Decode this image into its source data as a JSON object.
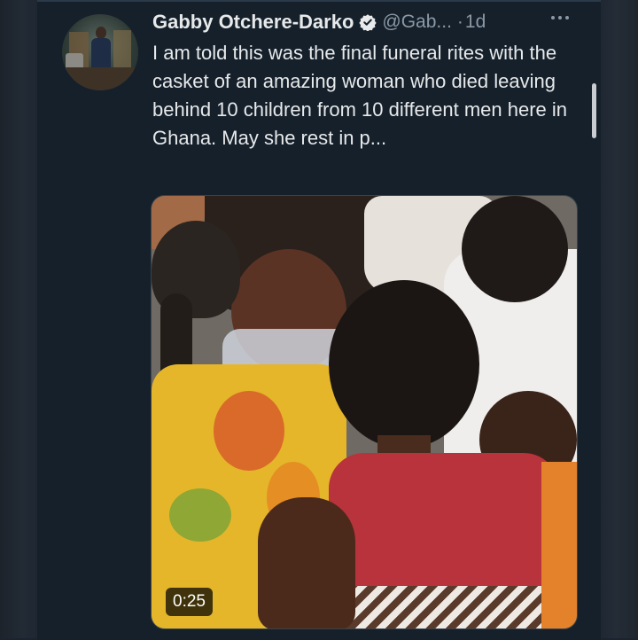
{
  "tweet": {
    "author_name": "Gabby Otchere-Darko",
    "handle": "@Gab...",
    "separator": "·",
    "timestamp": "1d",
    "text": "I am told this was the final funeral rites with the casket of an amazing woman who died leaving behind 10 children from 10 different men here in Ghana. May she rest in p...",
    "verified": true,
    "icons": {
      "verified": "verified-badge-icon",
      "more": "more-options-icon"
    }
  },
  "media": {
    "type": "video",
    "duration": "0:25"
  },
  "colors": {
    "background": "#15202b",
    "primary_text": "#e7e9ea",
    "secondary_text": "#8b98a5",
    "verified": "#e7e9ea"
  }
}
